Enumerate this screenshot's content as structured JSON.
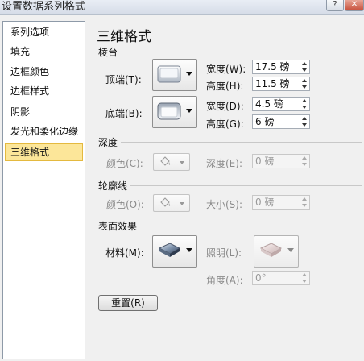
{
  "window": {
    "title": "设置数据系列格式",
    "help_glyph": "?",
    "close_glyph": "✕"
  },
  "sidebar": {
    "items": [
      {
        "label": "系列选项"
      },
      {
        "label": "填充"
      },
      {
        "label": "边框颜色"
      },
      {
        "label": "边框样式"
      },
      {
        "label": "阴影"
      },
      {
        "label": "发光和柔化边缘"
      },
      {
        "label": "三维格式",
        "selected": true
      }
    ]
  },
  "main": {
    "title": "三维格式",
    "bevel": {
      "section_label": "棱台",
      "top_label": "顶端(T):",
      "bottom_label": "底端(B):",
      "top_width_label": "宽度(W):",
      "top_width_value": "17.5 磅",
      "top_height_label": "高度(H):",
      "top_height_value": "11.5 磅",
      "bottom_width_label": "宽度(D):",
      "bottom_width_value": "4.5 磅",
      "bottom_height_label": "高度(G):",
      "bottom_height_value": "6 磅"
    },
    "depth": {
      "section_label": "深度",
      "color_label": "颜色(C):",
      "depth_label": "深度(E):",
      "depth_value": "0 磅"
    },
    "contour": {
      "section_label": "轮廓线",
      "color_label": "颜色(O):",
      "size_label": "大小(S):",
      "size_value": "0 磅"
    },
    "surface": {
      "section_label": "表面效果",
      "material_label": "材料(M):",
      "lighting_label": "照明(L):",
      "angle_label": "角度(A):",
      "angle_value": "0°"
    },
    "reset_label": "重置(R)"
  },
  "colors": {
    "accent_selected": "#fce699",
    "disabled_text": "#8a8a8a"
  },
  "icons": [
    "help-icon",
    "close-icon",
    "bevel-top-icon",
    "bevel-bottom-icon",
    "paint-bucket-icon",
    "material-icon",
    "lighting-icon",
    "spin-up-icon",
    "spin-down-icon",
    "dropdown-arrow-icon"
  ]
}
